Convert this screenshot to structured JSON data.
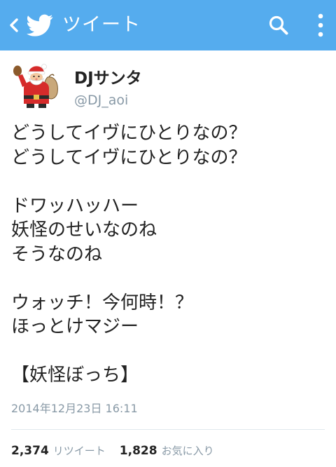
{
  "header": {
    "title": "ツイート",
    "back_icon": "chevron-left-icon",
    "logo_icon": "twitter-bird-icon",
    "search_icon": "search-icon",
    "menu_icon": "overflow-menu-icon",
    "bar_color": "#55acee"
  },
  "tweet": {
    "author": {
      "display_name": "DJサンタ",
      "username": "@DJ_aoi",
      "avatar": "santa-claus-avatar"
    },
    "lines": [
      "どうしてイヴにひとりなの？",
      "どうしてイヴにひとりなの？",
      "",
      "ドワッハッハー",
      "妖怪のせいなのね",
      "そうなのね",
      "",
      "ウォッチ！今何時！？",
      "ほっとけマジー",
      "",
      "【妖怪ぼっち】"
    ],
    "timestamp": "2014年12月23日 16:11",
    "retweet_count": "2,374",
    "retweet_label": "リツイート",
    "favorite_count": "1,828",
    "favorite_label": "お気に入り"
  },
  "colors": {
    "text": "#222222",
    "secondary_text": "#8899a6",
    "divider": "#e1e8ed"
  }
}
